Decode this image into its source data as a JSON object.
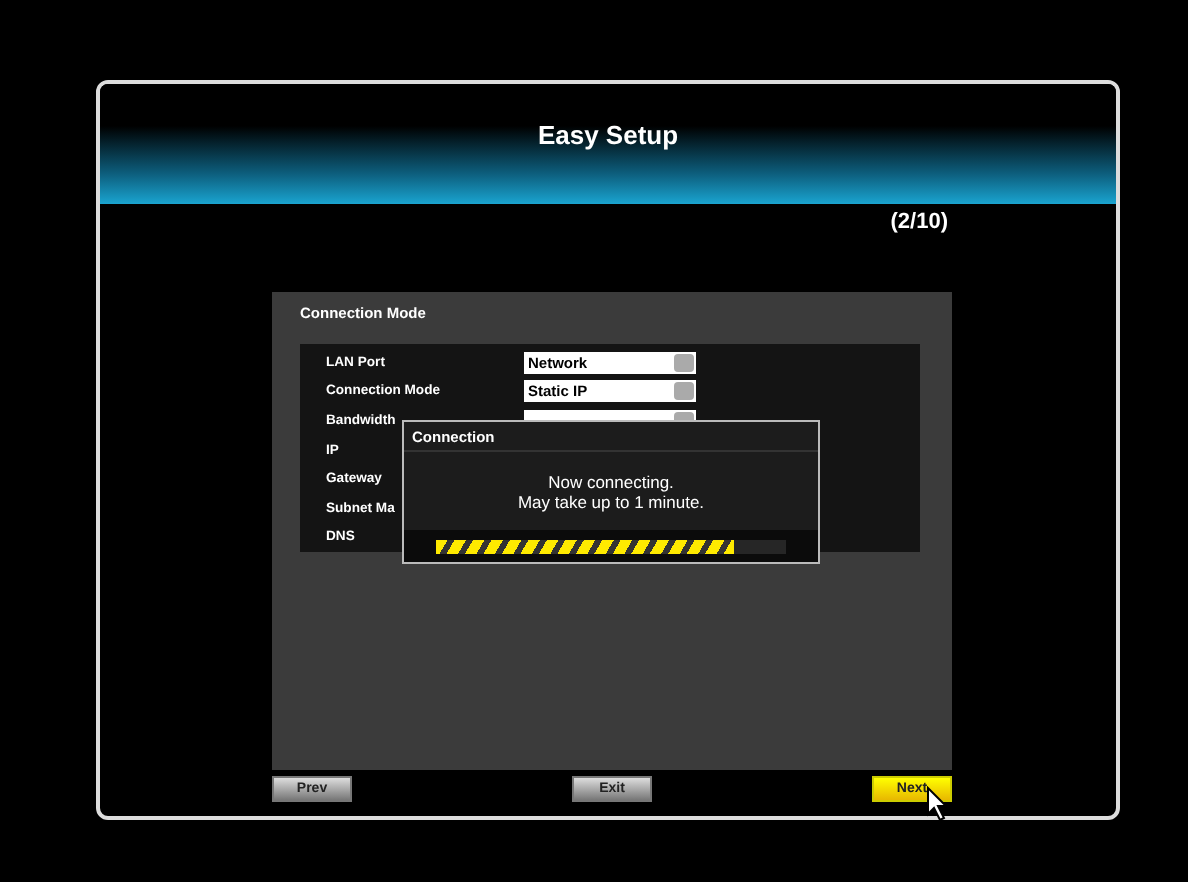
{
  "window": {
    "title": "Easy Setup",
    "step": "(2/10)"
  },
  "section": {
    "title": "Connection Mode"
  },
  "fields": [
    {
      "label": "LAN Port",
      "value": "Network"
    },
    {
      "label": "Connection Mode",
      "value": "Static IP"
    },
    {
      "label": "Bandwidth",
      "kind": "dropdown-hidden"
    },
    {
      "label": "IP",
      "kind": "plain"
    },
    {
      "label": "Gateway",
      "kind": "plain"
    },
    {
      "label": "Subnet Ma",
      "kind": "plain"
    },
    {
      "label": "DNS",
      "kind": "plain"
    }
  ],
  "dialog": {
    "title": "Connection",
    "message": [
      "Now connecting.",
      "May take up to 1 minute."
    ],
    "level": 0.85
  },
  "buttons": [
    {
      "label": "Prev",
      "selected": false
    },
    {
      "label": "Exit",
      "selected": false
    },
    {
      "label": "Next",
      "selected": true
    }
  ]
}
